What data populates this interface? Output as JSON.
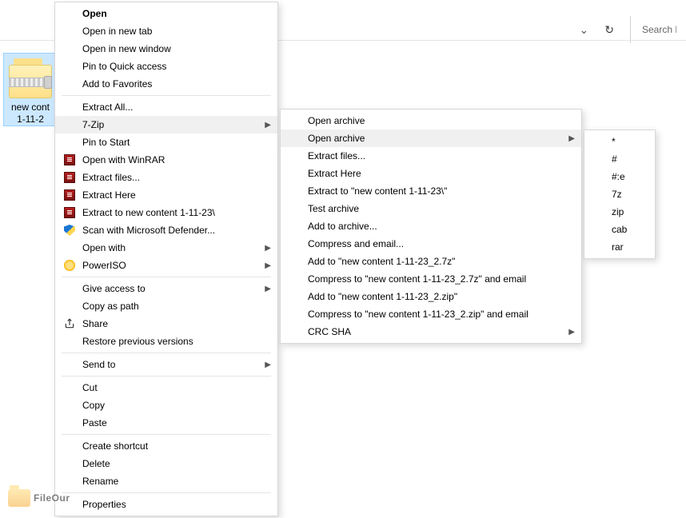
{
  "toolbar": {
    "search_placeholder": "Search N"
  },
  "file": {
    "name_line1": "new cont",
    "name_line2": "1-11-2"
  },
  "menu1": {
    "open": "Open",
    "open_new_tab": "Open in new tab",
    "open_new_window": "Open in new window",
    "pin_quick": "Pin to Quick access",
    "add_favorites": "Add to Favorites",
    "extract_all": "Extract All...",
    "seven_zip": "7-Zip",
    "pin_start": "Pin to Start",
    "open_winrar": "Open with WinRAR",
    "extract_files": "Extract files...",
    "extract_here": "Extract Here",
    "extract_to": "Extract to new content 1-11-23\\",
    "scan_defender": "Scan with Microsoft Defender...",
    "open_with": "Open with",
    "poweriso": "PowerISO",
    "give_access": "Give access to",
    "copy_path": "Copy as path",
    "share": "Share",
    "restore": "Restore previous versions",
    "send_to": "Send to",
    "cut": "Cut",
    "copy": "Copy",
    "paste": "Paste",
    "create_shortcut": "Create shortcut",
    "delete": "Delete",
    "rename": "Rename",
    "properties": "Properties"
  },
  "menu2": {
    "open_archive1": "Open archive",
    "open_archive2": "Open archive",
    "extract_files": "Extract files...",
    "extract_here": "Extract Here",
    "extract_to": "Extract to \"new content 1-11-23\\\"",
    "test_archive": "Test archive",
    "add_to_archive": "Add to archive...",
    "compress_email": "Compress and email...",
    "add_7z": "Add to \"new content 1-11-23_2.7z\"",
    "compress_7z_email": "Compress to \"new content 1-11-23_2.7z\" and email",
    "add_zip": "Add to \"new content 1-11-23_2.zip\"",
    "compress_zip_email": "Compress to \"new content 1-11-23_2.zip\" and email",
    "crc_sha": "CRC SHA"
  },
  "menu3": {
    "star": "*",
    "hash": "#",
    "hash_e": "#:e",
    "sevenz": "7z",
    "zip": "zip",
    "cab": "cab",
    "rar": "rar"
  },
  "watermark": "FileOur"
}
